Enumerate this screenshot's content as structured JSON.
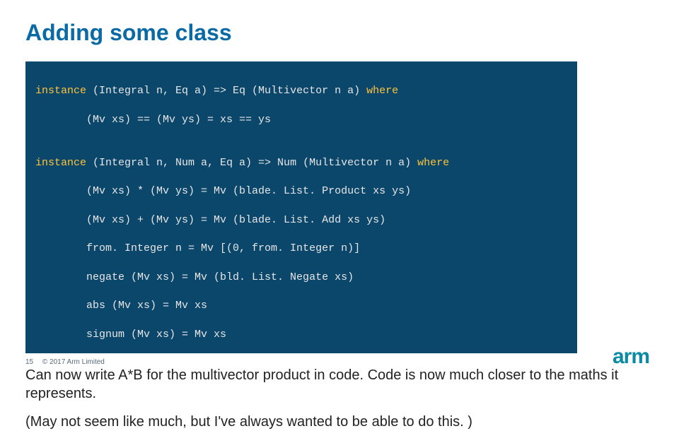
{
  "title": "Adding some class",
  "code": {
    "l1_a": "instance",
    "l1_b": " (Integral n, Eq a) => Eq (Multivector n a) ",
    "l1_c": "where",
    "l2": "        (Mv xs) == (Mv ys) = xs == ys",
    "blank1": "",
    "l3_a": "instance",
    "l3_b": " (Integral n, Num a, Eq a) => Num (Multivector n a) ",
    "l3_c": "where",
    "l4": "        (Mv xs) * (Mv ys) = Mv (blade. List. Product xs ys)",
    "l5": "        (Mv xs) + (Mv ys) = Mv (blade. List. Add xs ys)",
    "l6": "        from. Integer n = Mv [(0, from. Integer n)]",
    "l7": "        negate (Mv xs) = Mv (bld. List. Negate xs)",
    "l8": "        abs (Mv xs) = Mv xs",
    "l9": "        signum (Mv xs) = Mv xs"
  },
  "para1": "Can now write A*B for the multivector product in code. Code is now much closer to the maths it represents.",
  "para2": "(May not seem like much, but I've always wanted to be able to do this. )",
  "footer": {
    "page": "15",
    "copyright": "© 2017 Arm Limited"
  },
  "logo": "arm"
}
